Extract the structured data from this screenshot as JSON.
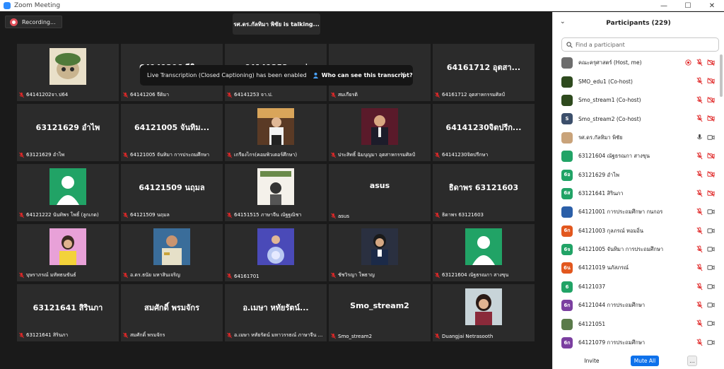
{
  "window": {
    "title": "Zoom Meeting"
  },
  "meeting": {
    "recording_label": "Recording...",
    "talking_text": "รศ.ดร.กัลทิมา พิชัย is talking...",
    "transcript": {
      "message": "Live Transcription (Closed Captioning) has been enabled",
      "who_link": "Who can see this transcript?",
      "close": "×"
    },
    "tiles": [
      {
        "big": "",
        "name": "64141202จา.ป64",
        "photo": "cat"
      },
      {
        "big": "64141206 จีติมา",
        "name": "64141206 จีติมา",
        "photo": ""
      },
      {
        "big": "64141253 จา.ป",
        "name": "64141253 จา.ป.",
        "photo": ""
      },
      {
        "big": "",
        "name": "สมเกียรติ",
        "photo": ""
      },
      {
        "big": "64161712 อุตสา...",
        "name": "64161712 อุตสาหกรรมศิลป์",
        "photo": ""
      },
      {
        "big": "63121629 อำไพ",
        "name": "63121629 อำไพ",
        "photo": ""
      },
      {
        "big": "64121005 จันทิม...",
        "name": "64121005 จันทิมา การประถมศึกษา",
        "photo": ""
      },
      {
        "big": "",
        "name": "เกรียงไกร(คอมพิวเตอร์ศึกษา)",
        "photo": "man-cafe"
      },
      {
        "big": "",
        "name": "ประสิทธิ์ ฉิมบุญมา อุตสาหกรรมศิลป์",
        "photo": "man-stage"
      },
      {
        "big": "64141230จิตปรีก...",
        "name": "64141230จิตปรีกษา",
        "photo": ""
      },
      {
        "big": "",
        "name": "64121222 นันทิพร โพธิ์ (ลูกเกด)",
        "photo": "generic"
      },
      {
        "big": "64121509 นฤมล",
        "name": "64121509 นฤมล",
        "photo": ""
      },
      {
        "big": "",
        "name": "64151515 ภาษาจีน ณัฐฐณิชา",
        "photo": "poster"
      },
      {
        "big": "asus",
        "name": "asus",
        "photo": ""
      },
      {
        "big": "ธิดาพร 63121603",
        "name": "ธิดาพร 63121603",
        "photo": ""
      },
      {
        "big": "",
        "name": "บุษราภรณ์ มหัทธนขันธ์",
        "photo": "woman-pink"
      },
      {
        "big": "",
        "name": "อ.ดร.ธนัย มหาสินเจริญ",
        "photo": "officer"
      },
      {
        "big": "",
        "name": "64161701",
        "photo": "blue-art"
      },
      {
        "big": "",
        "name": "ชัชวิรญา โพธาญ",
        "photo": "woman-suit"
      },
      {
        "big": "",
        "name": "63121604 ณัฐธรณกา สางขุน",
        "photo": "generic"
      },
      {
        "big": "63121641 สิรินภา",
        "name": "63121641 สิรินภา",
        "photo": ""
      },
      {
        "big": "สมศักดิ์ พรมจักร",
        "name": "สมศักดิ์ พรมจักร",
        "photo": ""
      },
      {
        "big": "อ.เมษา หทัยรัตน์...",
        "name": "อ.เมษา หทัยรัตน์ มหาวรรธณ์ ภาษาจีน ...",
        "photo": ""
      },
      {
        "big": "Smo_stream2",
        "name": "Smo_stream2",
        "photo": ""
      },
      {
        "big": "",
        "name": "Duangjai Netrasooth",
        "photo": "woman-photo"
      }
    ]
  },
  "participants": {
    "title": "Participants (229)",
    "search_placeholder": "Find a participant",
    "list": [
      {
        "name": "คณะครุศาสตร์ (Host, me)",
        "initial": "",
        "color": "#6d6d6d",
        "talking": false
      },
      {
        "name": "SMO_edu1 (Co-host)",
        "initial": "",
        "color": "#2e4a1e",
        "talking": false
      },
      {
        "name": "Smo_stream1 (Co-host)",
        "initial": "",
        "color": "#2e4a1e",
        "talking": false
      },
      {
        "name": "Smo_stream2 (Co-host)",
        "initial": "S",
        "color": "#3c4f6b",
        "talking": false
      },
      {
        "name": "รศ.ดร.กัลทิมา พิชัย",
        "initial": "",
        "color": "#c9a37a",
        "talking": true
      },
      {
        "name": "63121604 ณัฐธรณกา สางขุน",
        "initial": "",
        "color": "#21a366",
        "talking": false
      },
      {
        "name": "63121629 อำไพ",
        "initial": "6อ",
        "color": "#21a366",
        "talking": false
      },
      {
        "name": "63121641 สิรินภา",
        "initial": "6ส",
        "color": "#21a366",
        "talking": false
      },
      {
        "name": "64121001 การประถมศึกษา กนกอร",
        "initial": "",
        "color": "#2b5fa8",
        "talking": false
      },
      {
        "name": "64121003 กุลภรณ์ หอมอิ่น",
        "initial": "6ก",
        "color": "#e2571e",
        "talking": false
      },
      {
        "name": "64121005 จันทิมา การประถมศึกษา",
        "initial": "6จ",
        "color": "#21a366",
        "talking": false
      },
      {
        "name": "64121019 นภัสภรณ์",
        "initial": "6น",
        "color": "#e2571e",
        "talking": false
      },
      {
        "name": "64121037",
        "initial": "6",
        "color": "#21a366",
        "talking": false
      },
      {
        "name": "64121044 การประถมศึกษา",
        "initial": "6ก",
        "color": "#7b3fa0",
        "talking": false
      },
      {
        "name": "64121051",
        "initial": "",
        "color": "#5a7a4a",
        "talking": false
      },
      {
        "name": "64121079 การประถมศึกษา",
        "initial": "6ก",
        "color": "#7b3fa0",
        "talking": false
      }
    ],
    "footer": {
      "invite": "Invite",
      "mute_all": "Mute All",
      "more": "..."
    }
  },
  "colors": {
    "accent": "#0e71eb",
    "muted_red": "#e02828",
    "tile_bg": "#2b2b2b"
  }
}
